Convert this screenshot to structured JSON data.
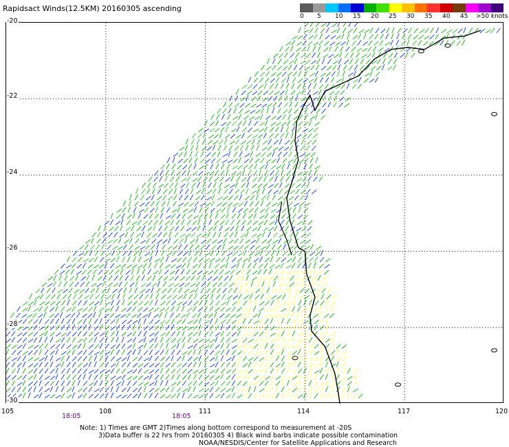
{
  "title": "Rapidsact Winds(12.5KM) 20160305 ascending",
  "legend": {
    "colors": [
      "#5a5a5a",
      "#9a9a9a",
      "#00c8ff",
      "#0070ff",
      "#0000d0",
      "#00b000",
      "#40e000",
      "#ffff00",
      "#ffc000",
      "#ff7000",
      "#ff3030",
      "#d00000",
      "#7a3a10",
      "#ff00ff",
      "#a000d0",
      "#400080"
    ],
    "labels": [
      "0",
      "5",
      "10",
      "15",
      "20",
      "25",
      "30",
      "35",
      "40",
      "45",
      ">50 knots"
    ]
  },
  "latitude_labels": [
    "-20",
    "-22",
    "-24",
    "-26",
    "-28",
    "-30"
  ],
  "longitude_labels": [
    "105",
    "108",
    "111",
    "114",
    "117",
    "120"
  ],
  "time_labels": [
    "18:05",
    "18:05"
  ],
  "notes": [
    "Note: 1) Times are GMT 2)Times along bottom correspond to measurement at -20S",
    "3)Data buffer is 22 hrs from 20160305 4) Black wind barbs indicate possible contamination",
    "NOAA/NESDIS/Center for Satellite Applications and Research"
  ],
  "map_data": {
    "projection": "equirectangular",
    "lon_range": [
      105,
      120
    ],
    "lat_range": [
      -30,
      -20
    ],
    "grid": true,
    "region": "Western Australia coast",
    "coastline_color": "#000000"
  }
}
